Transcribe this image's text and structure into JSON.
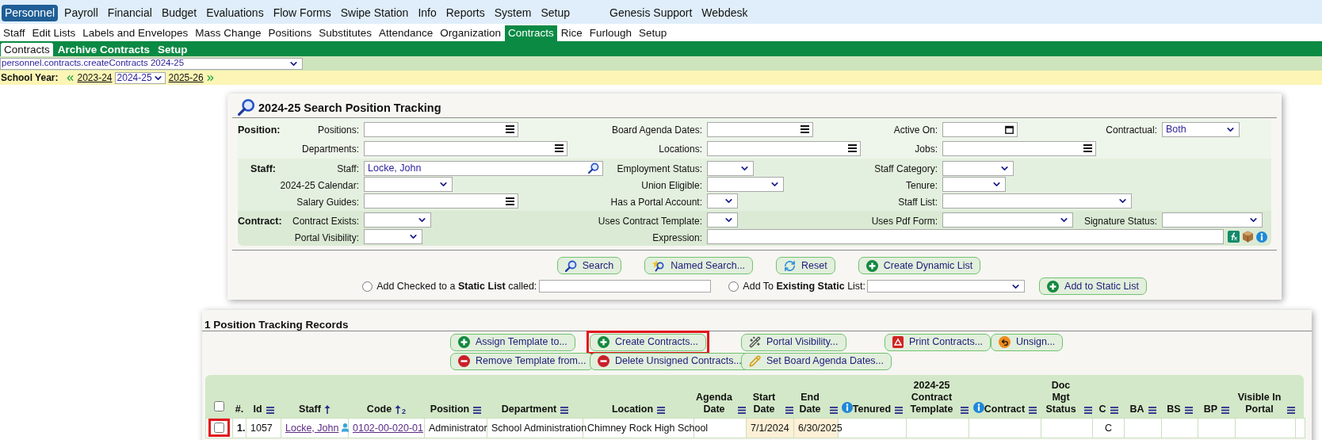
{
  "main_menu": {
    "items": [
      {
        "label": "Personnel",
        "selected": true
      },
      {
        "label": "Payroll",
        "selected": false
      },
      {
        "label": "Financial",
        "selected": false
      },
      {
        "label": "Budget",
        "selected": false
      },
      {
        "label": "Evaluations",
        "selected": false
      },
      {
        "label": "Flow Forms",
        "selected": false
      },
      {
        "label": "Swipe Station",
        "selected": false
      },
      {
        "label": "Info",
        "selected": false
      },
      {
        "label": "Reports",
        "selected": false
      },
      {
        "label": "System",
        "selected": false
      },
      {
        "label": "Setup",
        "selected": false
      }
    ],
    "extra_items": [
      {
        "label": "Genesis Support",
        "selected": false
      },
      {
        "label": "Webdesk",
        "selected": false
      }
    ]
  },
  "sub_menu": [
    {
      "label": "Staff",
      "selected": false
    },
    {
      "label": "Edit Lists",
      "selected": false
    },
    {
      "label": "Labels and Envelopes",
      "selected": false
    },
    {
      "label": "Mass Change",
      "selected": false
    },
    {
      "label": "Positions",
      "selected": false
    },
    {
      "label": "Substitutes",
      "selected": false
    },
    {
      "label": "Attendance",
      "selected": false
    },
    {
      "label": "Organization",
      "selected": false
    },
    {
      "label": "Contracts",
      "selected": true
    },
    {
      "label": "Rice",
      "selected": false
    },
    {
      "label": "Furlough",
      "selected": false
    },
    {
      "label": "Setup",
      "selected": false
    }
  ],
  "tabs": [
    {
      "label": "Contracts",
      "selected": true
    },
    {
      "label": "Archive Contracts",
      "selected": false
    },
    {
      "label": "Setup",
      "selected": false
    }
  ],
  "report_select": {
    "value": "personnel.contracts.createContracts 2024-25"
  },
  "school_year": {
    "label": "School Year:",
    "previous": "2023-24",
    "current": "2024-25",
    "next": "2025-26"
  },
  "search_panel": {
    "title": "2024-25 Search Position Tracking",
    "sections": [
      {
        "label": "Position:",
        "rows": [
          [
            {
              "label": "Positions:",
              "kind": "list"
            },
            {
              "label": "Board Agenda Dates:",
              "kind": "list"
            },
            {
              "label": "Active On:",
              "kind": "date"
            },
            {
              "label": "Contractual:",
              "kind": "select",
              "value": "Both"
            }
          ],
          [
            {
              "label": "Departments:",
              "kind": "list"
            },
            {
              "label": "Locations:",
              "kind": "list"
            },
            {
              "label": "Jobs:",
              "kind": "list"
            },
            null
          ]
        ]
      },
      {
        "label": "Staff:",
        "rows": [
          [
            {
              "label": "Staff:",
              "kind": "search",
              "value": "Locke, John"
            },
            {
              "label": "Employment Status:",
              "kind": "select"
            },
            {
              "label": "Staff Category:",
              "kind": "select"
            },
            null
          ],
          [
            {
              "label": "2024-25 Calendar:",
              "kind": "select"
            },
            {
              "label": "Union Eligible:",
              "kind": "select"
            },
            {
              "label": "Tenure:",
              "kind": "select"
            },
            null
          ],
          [
            {
              "label": "Salary Guides:",
              "kind": "list"
            },
            {
              "label": "Has a Portal Account:",
              "kind": "select"
            },
            {
              "label": "Staff List:",
              "kind": "select"
            },
            null
          ]
        ]
      },
      {
        "label": "Contract:",
        "rows": [
          [
            {
              "label": "Contract Exists:",
              "kind": "select"
            },
            {
              "label": "Uses Contract Template:",
              "kind": "select"
            },
            {
              "label": "Uses Pdf Form:",
              "kind": "select"
            },
            {
              "label": "Signature Status:",
              "kind": "select"
            }
          ],
          [
            {
              "label": "Portal Visibility:",
              "kind": "select"
            },
            {
              "label": "Expression:",
              "kind": "expression"
            },
            null,
            null
          ]
        ]
      }
    ],
    "buttons": [
      {
        "label": "Search",
        "kind": "search"
      },
      {
        "label": "Named Search...",
        "kind": "named_search"
      },
      {
        "label": "Reset",
        "kind": "reset"
      },
      {
        "label": "Create Dynamic List",
        "kind": "plus"
      }
    ],
    "static_list": {
      "new_option": {
        "text": "Add Checked to a **Static List** called:",
        "selected": false
      },
      "existing_option": {
        "text": "Add To **Existing Static** List:",
        "selected": false
      },
      "button": {
        "label": "Add to Static List",
        "kind": "plus"
      }
    }
  },
  "records": {
    "title": "1 Position Tracking Records",
    "button_rows": [
      [
        {
          "label": "Assign Template to...",
          "kind": "plus",
          "highlighted": false
        },
        {
          "label": "Create Contracts...",
          "kind": "plus",
          "highlighted": true
        },
        {
          "label": "Portal Visibility...",
          "kind": "wand",
          "highlighted": false
        },
        {
          "label": "Print Contracts...",
          "kind": "pdf",
          "highlighted": false
        },
        {
          "label": "Unsign...",
          "kind": "undo",
          "highlighted": false
        }
      ],
      [
        {
          "label": "Remove Template from...",
          "kind": "minus",
          "highlighted": false
        },
        {
          "label": "Delete Unsigned Contracts...",
          "kind": "minus",
          "highlighted": false
        },
        {
          "label": "Set Board Agenda Dates...",
          "kind": "pencil",
          "highlighted": false
        },
        null,
        null
      ]
    ],
    "select_all": {
      "checked": false
    },
    "columns": [
      {
        "label": "#.",
        "kind": "number",
        "filter": false,
        "sorted": false,
        "info": false
      },
      {
        "label": "Id",
        "kind": "text",
        "filter": true,
        "sorted": false,
        "info": false
      },
      {
        "label": "Staff",
        "kind": "staff",
        "filter": false,
        "sorted": true,
        "info": false
      },
      {
        "label": "Code",
        "kind": "link",
        "filter": false,
        "sorted": true,
        "sort_order": "2",
        "info": false
      },
      {
        "label": "Position",
        "kind": "text",
        "filter": true,
        "sorted": false,
        "info": false
      },
      {
        "label": "Department",
        "kind": "text",
        "filter": true,
        "sorted": false,
        "info": false
      },
      {
        "label": "Location",
        "kind": "text",
        "filter": true,
        "sorted": false,
        "info": false
      },
      {
        "label": "Agenda Date",
        "kind": "text",
        "filter": true,
        "sorted": false,
        "info": false
      },
      {
        "label": "Start Date",
        "kind": "date",
        "filter": true,
        "sorted": false,
        "info": false
      },
      {
        "label": "End Date",
        "kind": "date",
        "filter": true,
        "sorted": false,
        "info": false
      },
      {
        "label": "Tenured",
        "kind": "text",
        "filter": true,
        "sorted": false,
        "info": true
      },
      {
        "label": "2024-25 Contract Template",
        "kind": "text",
        "filter": true,
        "sorted": false,
        "info": false
      },
      {
        "label": "Contract",
        "kind": "text",
        "filter": true,
        "sorted": false,
        "info": true
      },
      {
        "label": "Doc Mgt Status",
        "kind": "text",
        "filter": true,
        "sorted": false,
        "info": false
      },
      {
        "label": "C",
        "kind": "center",
        "filter": true,
        "sorted": false,
        "info": false
      },
      {
        "label": "BA",
        "kind": "text",
        "filter": true,
        "sorted": false,
        "info": false
      },
      {
        "label": "BS",
        "kind": "text",
        "filter": true,
        "sorted": false,
        "info": false
      },
      {
        "label": "BP",
        "kind": "text",
        "filter": true,
        "sorted": false,
        "info": false
      },
      {
        "label": "Visible In Portal",
        "kind": "text",
        "filter": true,
        "sorted": false,
        "info": false
      }
    ],
    "rows": [
      {
        "checked": false,
        "highlighted": true,
        "cells": [
          "1.",
          "1057",
          "Locke, John",
          "0102-00-020-01",
          "Administrator",
          "School Administration",
          "Chimney Rock High School",
          null,
          "7/1/2024",
          "6/30/2025",
          null,
          null,
          null,
          null,
          "C",
          null,
          null,
          null,
          null
        ]
      }
    ]
  }
}
